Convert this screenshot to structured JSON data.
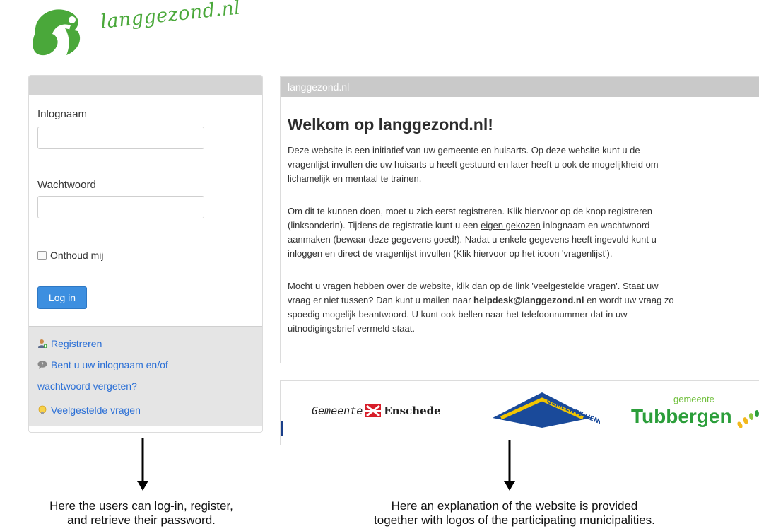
{
  "logo": {
    "text": "langgezond.nl"
  },
  "login": {
    "username_label": "Inlognaam",
    "password_label": "Wachtwoord",
    "remember_label": "Onthoud mij",
    "login_button": "Log in",
    "links": {
      "register": "Registreren",
      "forgot_line1": "Bent u uw inlognaam en/of",
      "forgot_line2": "wachtwoord vergeten?",
      "faq": "Veelgestelde vragen"
    }
  },
  "content": {
    "header": "langgezond.nl",
    "title": "Welkom op langgezond.nl!",
    "para1": {
      "line1": "Deze website is een initiatief van uw gemeente en huisarts. Op deze website kunt u de",
      "line2": "vragenlijst invullen die uw huisarts u heeft gestuurd en later heeft u ook de mogelijkheid om",
      "line3": "lichamelijk en mentaal te trainen."
    },
    "para2": {
      "line1": "Om dit te kunnen doen, moet u zich eerst registreren. Klik hiervoor op de knop registreren",
      "line2_pre": "(linksonderin). Tijdens de registratie kunt u een ",
      "line2_u": "eigen gekozen",
      "line2_post": " inlognaam en wachtwoord",
      "line3": "aanmaken (bewaar deze gegevens goed!). Nadat u enkele gegevens heeft ingevuld kunt u",
      "line4": "inloggen en direct de vragenlijst invullen (Klik hiervoor op het icoon 'vragenlijst')."
    },
    "para3": {
      "line1": "Mocht u vragen hebben over de website, klik dan op de link 'veelgestelde vragen'. Staat uw",
      "line2_pre": "vraag er niet tussen? Dan kunt u mailen naar ",
      "line2_b": "helpdesk@langgezond.nl",
      "line2_post": " en wordt uw vraag zo",
      "line3": "spoedig mogelijk beantwoord. U kunt ook bellen naar het telefoonnummer dat in uw",
      "line4": "uitnodigingsbrief vermeld staat."
    }
  },
  "logos": {
    "enschede_1": "Gemeente",
    "enschede_2": "Enschede",
    "hengelo_text": "GEMEENTE HENGELO",
    "tubbergen_small": "gemeente",
    "tubbergen_big": "Tubbergen"
  },
  "captions": {
    "left_line1": "Here the users can log-in, register,",
    "left_line2": "and retrieve their password.",
    "right_line1": "Here an explanation of the website is provided",
    "right_line2": "together with logos of the participating municipalities."
  },
  "colors": {
    "brand_green": "#4aa83a",
    "button_blue": "#3d8fe0",
    "link_blue": "#2a6fd6"
  }
}
